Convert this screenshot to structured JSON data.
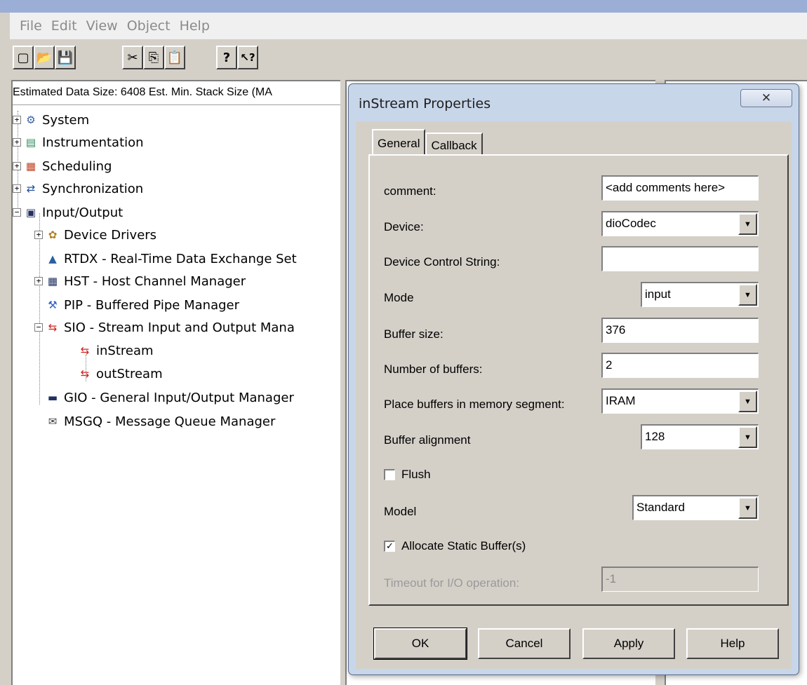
{
  "menu": [
    "File",
    "Edit",
    "View",
    "Object",
    "Help"
  ],
  "toolbar": {
    "buttons": [
      "new-file",
      "open-folder",
      "save",
      "cut",
      "copy",
      "paste",
      "help",
      "context-help"
    ],
    "glyphs": [
      "▢",
      "📂",
      "💾",
      "✂",
      "⎘",
      "📋",
      "?",
      "↖?"
    ]
  },
  "left_panel": {
    "status_text": "Estimated Data Size: 6408   Est. Min. Stack Size (MA",
    "tree": [
      {
        "label": "System",
        "icon": "system-icon",
        "glyph": "⚙"
      },
      {
        "label": "Instrumentation",
        "icon": "instrumentation-icon",
        "glyph": "▤"
      },
      {
        "label": "Scheduling",
        "icon": "scheduling-icon",
        "glyph": "▦"
      },
      {
        "label": "Synchronization",
        "icon": "synchronization-icon",
        "glyph": "⇄"
      },
      {
        "label": "Input/Output",
        "icon": "io-icon",
        "glyph": "▣"
      },
      {
        "label": "Device Drivers",
        "icon": "device-drivers-icon",
        "glyph": "✿"
      },
      {
        "label": "RTDX - Real-Time Data Exchange Set",
        "icon": "rtdx-icon",
        "glyph": "▲"
      },
      {
        "label": "HST - Host Channel Manager",
        "icon": "hst-icon",
        "glyph": "▦"
      },
      {
        "label": "PIP - Buffered Pipe Manager",
        "icon": "pip-icon",
        "glyph": "⚒"
      },
      {
        "label": "SIO - Stream Input and Output Mana",
        "icon": "sio-icon",
        "glyph": "⇆"
      },
      {
        "label": "inStream",
        "icon": "stream-icon",
        "glyph": "⇆"
      },
      {
        "label": "outStream",
        "icon": "stream-icon",
        "glyph": "⇆"
      },
      {
        "label": "GIO - General Input/Output Manager",
        "icon": "gio-icon",
        "glyph": "▬"
      },
      {
        "label": "MSGQ - Message Queue Manager",
        "icon": "msgq-icon",
        "glyph": "✉"
      }
    ]
  },
  "dialog": {
    "title": "inStream Properties",
    "close_glyph": "✕",
    "tabs": [
      "General",
      "Callback"
    ],
    "fields": {
      "comment_label": "comment:",
      "comment_value": "<add comments here>",
      "device_label": "Device:",
      "device_value": "dioCodec",
      "control_label": "Device Control String:",
      "control_value": "",
      "mode_label": "Mode",
      "mode_value": "input",
      "buffer_size_label": "Buffer size:",
      "buffer_size_value": "376",
      "num_buffers_label": "Number of buffers:",
      "num_buffers_value": "2",
      "segment_label": "Place buffers in memory segment:",
      "segment_value": "IRAM",
      "alignment_label": "Buffer alignment",
      "alignment_value": "128",
      "flush_label": "Flush",
      "model_label": "Model",
      "model_value": "Standard",
      "allocate_label": "Allocate Static Buffer(s)",
      "allocate_mark": "✓",
      "timeout_label": "Timeout for I/O operation:",
      "timeout_value": "-1"
    },
    "buttons": {
      "ok": "OK",
      "cancel": "Cancel",
      "apply": "Apply",
      "help": "Help"
    }
  }
}
